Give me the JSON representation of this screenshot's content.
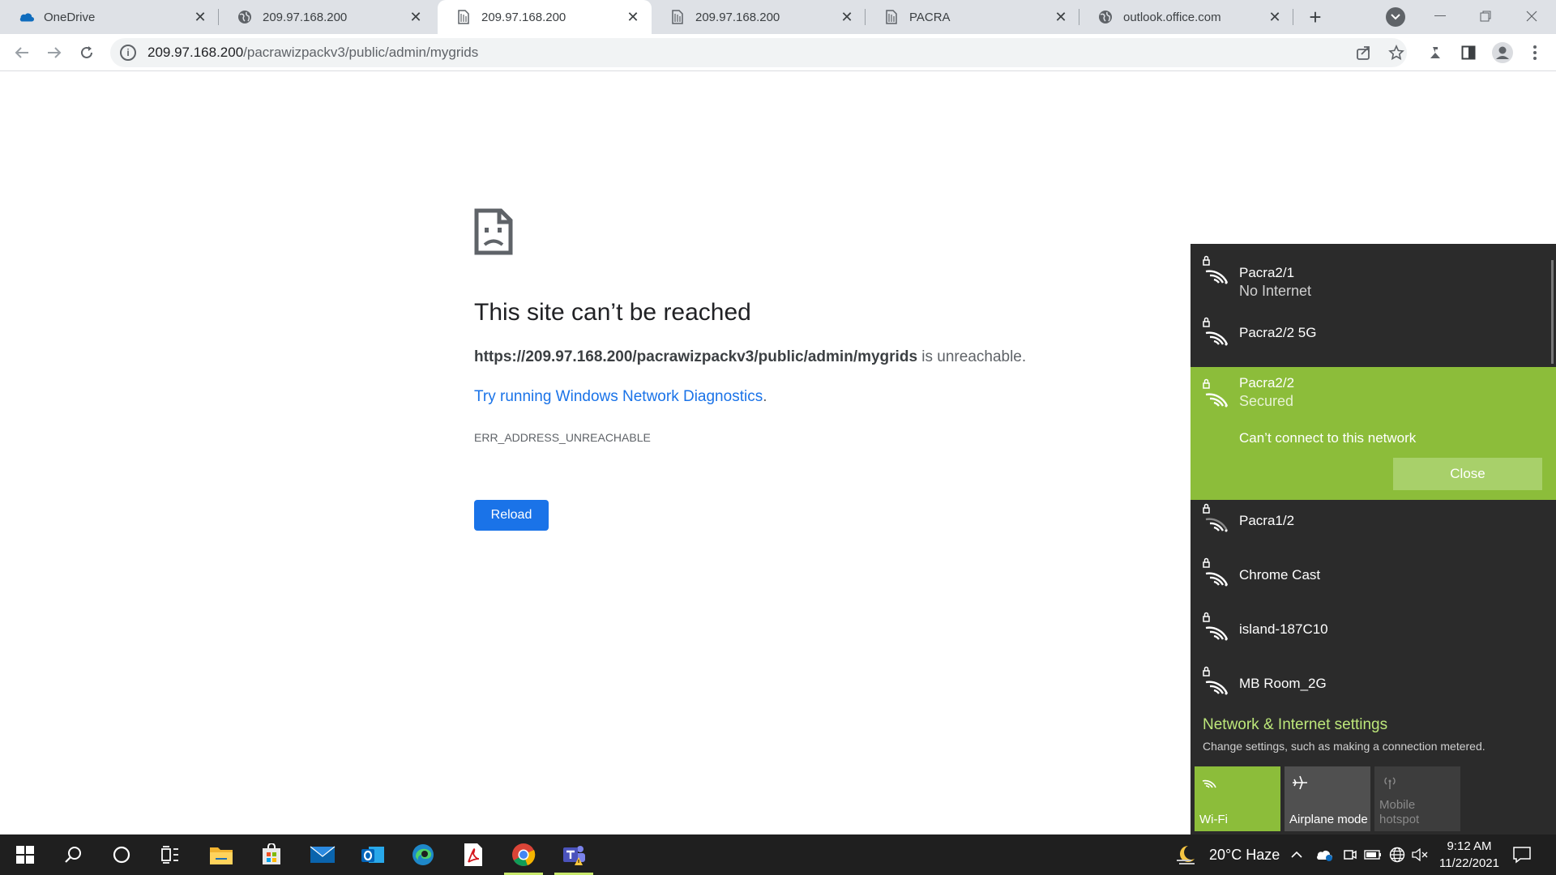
{
  "tabs": [
    {
      "title": "OneDrive",
      "icon": "onedrive-icon",
      "active": false
    },
    {
      "title": "209.97.168.200",
      "icon": "globe-icon",
      "active": false
    },
    {
      "title": "209.97.168.200",
      "icon": "page-icon",
      "active": true
    },
    {
      "title": "209.97.168.200",
      "icon": "page-icon",
      "active": false
    },
    {
      "title": "PACRA",
      "icon": "page-icon",
      "active": false
    },
    {
      "title": "outlook.office.com",
      "icon": "globe-icon",
      "active": false
    }
  ],
  "toolbar": {
    "url_host": "209.97.168.200",
    "url_path": "/pacrawizpackv3/public/admin/mygrids"
  },
  "error": {
    "title": "This site can’t be reached",
    "url_bold": "https://209.97.168.200/pacrawizpackv3/public/admin/mygrids",
    "unreachable": " is unreachable.",
    "diagnostics_link": "Try running Windows Network Diagnostics",
    "diagnostics_tail": ".",
    "code": "ERR_ADDRESS_UNREACHABLE",
    "reload": "Reload"
  },
  "networks": [
    {
      "name": "Pacra2/1",
      "status": "No Internet"
    },
    {
      "name": "Pacra2/2 5G",
      "status": ""
    },
    {
      "name": "Pacra2/2",
      "status": "Secured",
      "message": "Can’t connect to this network",
      "button": "Close"
    },
    {
      "name": "Pacra1/2",
      "status": ""
    },
    {
      "name": "Chrome Cast",
      "status": ""
    },
    {
      "name": "island-187C10",
      "status": ""
    },
    {
      "name": "MB Room_2G",
      "status": ""
    }
  ],
  "network_settings": {
    "title": "Network & Internet settings",
    "subtitle": "Change settings, such as making a connection metered."
  },
  "quick_actions": [
    {
      "label": "Wi-Fi",
      "state": "on",
      "color": "#8cbd3a"
    },
    {
      "label": "Airplane mode",
      "state": "off",
      "color": "#505050"
    },
    {
      "label_line1": "Mobile",
      "label_line2": "hotspot",
      "state": "disabled",
      "color": "#3d3d3d"
    }
  ],
  "taskbar": {
    "weather": "20°C  Haze",
    "time": "9:12 AM",
    "date": "11/22/2021",
    "accent": "#c8e86b"
  }
}
